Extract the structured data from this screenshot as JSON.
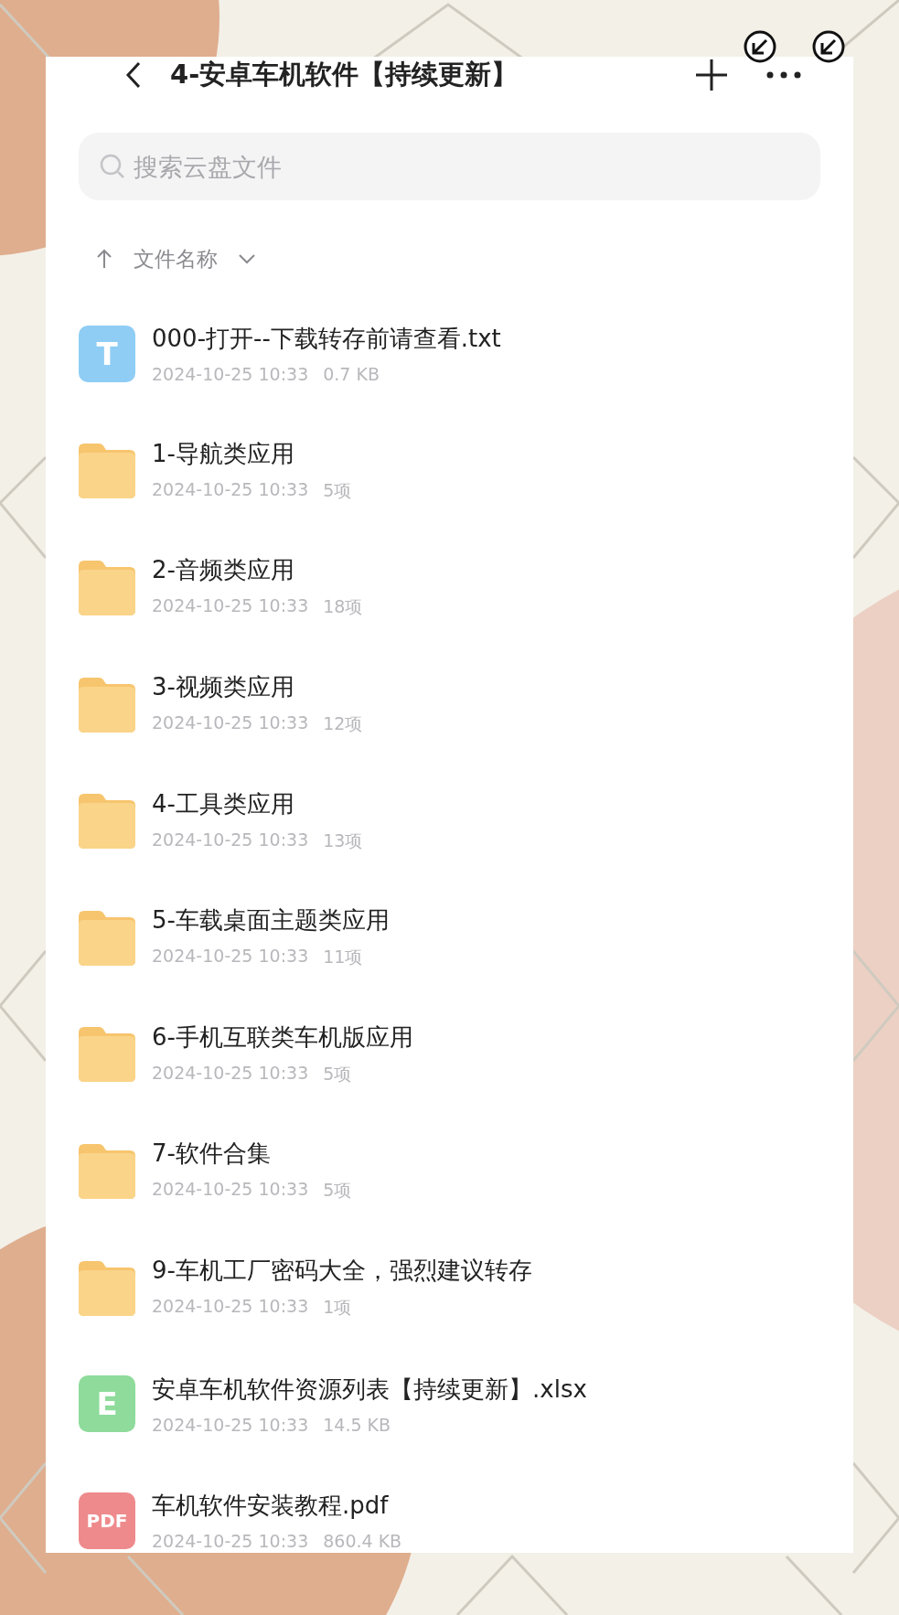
{
  "header": {
    "title": "4-安卓车机软件【持续更新】"
  },
  "search": {
    "placeholder": "搜索云盘文件"
  },
  "sort": {
    "label": "文件名称"
  },
  "files": [
    {
      "name": "000-打开--下载转存前请查看.txt",
      "date": "2024-10-25 10:33",
      "size": "0.7 KB",
      "icon": {
        "kind": "txt",
        "label": "T"
      }
    },
    {
      "name": "1-导航类应用",
      "date": "2024-10-25 10:33",
      "size": "5项",
      "icon": {
        "kind": "folder"
      }
    },
    {
      "name": "2-音频类应用",
      "date": "2024-10-25 10:33",
      "size": "18项",
      "icon": {
        "kind": "folder"
      }
    },
    {
      "name": "3-视频类应用",
      "date": "2024-10-25 10:33",
      "size": "12项",
      "icon": {
        "kind": "folder"
      }
    },
    {
      "name": "4-工具类应用",
      "date": "2024-10-25 10:33",
      "size": "13项",
      "icon": {
        "kind": "folder"
      }
    },
    {
      "name": "5-车载桌面主题类应用",
      "date": "2024-10-25 10:33",
      "size": "11项",
      "icon": {
        "kind": "folder"
      }
    },
    {
      "name": "6-手机互联类车机版应用",
      "date": "2024-10-25 10:33",
      "size": "5项",
      "icon": {
        "kind": "folder"
      }
    },
    {
      "name": "7-软件合集",
      "date": "2024-10-25 10:33",
      "size": "5项",
      "icon": {
        "kind": "folder"
      }
    },
    {
      "name": "9-车机工厂密码大全，强烈建议转存",
      "date": "2024-10-25 10:33",
      "size": "1项",
      "icon": {
        "kind": "folder"
      }
    },
    {
      "name": "安卓车机软件资源列表【持续更新】.xlsx",
      "date": "2024-10-25 10:33",
      "size": "14.5 KB",
      "icon": {
        "kind": "xlsx",
        "label": "E"
      }
    },
    {
      "name": "车机软件安装教程.pdf",
      "date": "2024-10-25 10:33",
      "size": "860.4 KB",
      "icon": {
        "kind": "pdf",
        "label": "PDF"
      }
    }
  ]
}
